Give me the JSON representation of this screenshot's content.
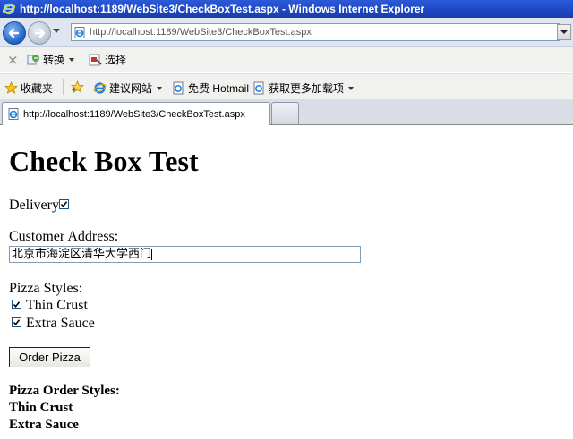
{
  "window": {
    "title": "http://localhost:1189/WebSite3/CheckBoxTest.aspx - Windows Internet Explorer"
  },
  "toolbar": {
    "address_url": "http://localhost:1189/WebSite3/CheckBoxTest.aspx",
    "convert_label": "转换",
    "select_label": "选择"
  },
  "favorites_bar": {
    "favorites_label": "收藏夹",
    "suggested_sites_label": "建议网站",
    "hotmail_label": "免费 Hotmail",
    "more_addons_label": "获取更多加载项"
  },
  "tabs": [
    {
      "label": "http://localhost:1189/WebSite3/CheckBoxTest.aspx"
    }
  ],
  "page": {
    "title": "Check Box Test",
    "delivery_label": "Delivery:",
    "delivery_checked": true,
    "customer_address_label": "Customer Address:",
    "customer_address_value": "北京市海淀区清华大学西门",
    "pizza_styles_label": "Pizza Styles:",
    "styles": [
      {
        "label": "Thin Crust",
        "checked": true
      },
      {
        "label": "Extra Sauce",
        "checked": true
      }
    ],
    "order_button_label": "Order Pizza",
    "result_heading": "Pizza Order Styles:",
    "result_lines": [
      "Thin Crust",
      "Extra Sauce"
    ]
  }
}
